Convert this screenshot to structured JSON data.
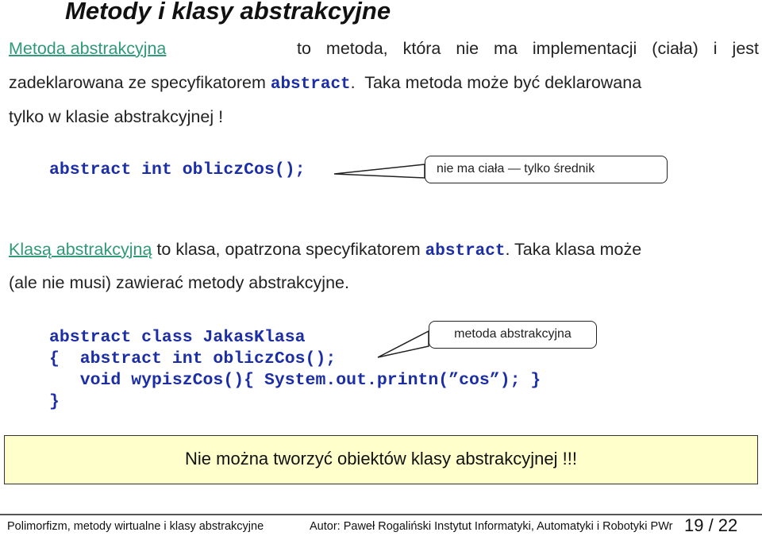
{
  "slide": {
    "title": "Metody i klasy abstrakcyjne",
    "p1": {
      "term": "Metoda abstrakcyjna",
      "l1_rest": "to metoda, która nie ma implementacji (ciała) i jest",
      "l2_a": "zadeklarowana ze specyfikatorem",
      "keyword": "abstract",
      "l2_b": ".  Taka metoda może być deklarowana",
      "l3": "tylko w klasie abstrakcyjnej !"
    },
    "code1": "abstract int obliczCos();",
    "callout1": "nie  ma  ciała  —  tylko  średnik",
    "p2": {
      "term": "Klasą abstrakcyjną",
      "l1_a": "to klasa, opatrzona specyfikatorem",
      "keyword": "abstract",
      "l1_b": ". Taka klasa może",
      "l2": "(ale nie musi) zawierać metody abstrakcyjne."
    },
    "code2": [
      "abstract class JakasKlasa",
      "{  abstract int obliczCos();",
      "   void wypiszCos(){ System.out.printn(”cos”); }",
      "}"
    ],
    "callout2": "metoda abstrakcyjna",
    "note": "Nie można tworzyć obiektów klasy abstrakcyjnej !!!"
  },
  "footer": {
    "left": "Polimorfizm, metody wirtualne i klasy abstrakcyjne",
    "author": "Autor: Paweł Rogaliński  Instytut Informatyki, Automatyki i Robotyki PWr",
    "page": "19 / 22"
  },
  "colors": {
    "term": "#2f9a78",
    "code": "#1c2ea6",
    "note_bg": "#ffffcc"
  }
}
